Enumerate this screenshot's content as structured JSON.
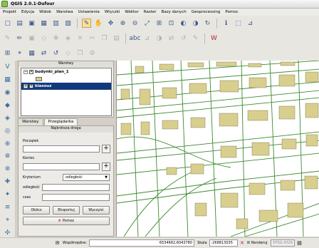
{
  "window": {
    "title": "QGIS 2.0.1-Dufour"
  },
  "menu": [
    "Projekt",
    "Edycja",
    "Widok",
    "Warstwa",
    "Ustawienia",
    "Wtyczki",
    "Wektor",
    "Raster",
    "Bazy danych",
    "Geoprocessing",
    "Pomoc"
  ],
  "toolbar_icons": {
    "row1": [
      "new-project-icon",
      "open-project-icon",
      "save-project-icon",
      "save-as-icon",
      "print-composer-icon",
      "composer-manager-icon",
      "touch-zoom-icon",
      "pan-icon",
      "pan-to-selection-icon",
      "zoom-in-icon",
      "zoom-out-icon",
      "zoom-full-icon",
      "zoom-layer-icon",
      "zoom-selection-icon",
      "zoom-last-icon",
      "zoom-next-icon",
      "refresh-icon",
      "identify-icon",
      "select-icon",
      "measure-icon"
    ],
    "row2": [
      "current-edits-icon",
      "toggle-editing-icon",
      "save-edits-icon",
      "add-feature-icon",
      "move-feature-icon",
      "node-tool-icon",
      "delete-selected-icon",
      "cut-features-icon",
      "copy-features-icon",
      "paste-features-icon",
      "label-icon",
      "pin-label-icon",
      "show-label-icon",
      "move-label-icon",
      "rotate-label-icon",
      "change-label-icon",
      "wms-icon"
    ],
    "row3": [
      "layer-label-icon",
      "pin-icon",
      "highlight-icon",
      "move-icon",
      "rotate-icon",
      "change-icon",
      "copy-icon",
      "label-settings-icon"
    ]
  },
  "vertical_toolbar": [
    "add-vector-icon",
    "add-raster-icon",
    "add-postgis-icon",
    "add-spatialite-icon",
    "add-mssql-icon",
    "add-oracle-icon",
    "add-wms-icon",
    "add-wcs-icon",
    "add-wfs-icon",
    "new-shapefile-icon",
    "new-spatialite-icon",
    "add-delimited-icon",
    "gps-icon",
    "add-geonode-icon"
  ],
  "layers_panel": {
    "header": "Warstwy",
    "layers": [
      {
        "name": "budynki_plan_1",
        "checked": "✕",
        "color": "#d8cf8f"
      },
      {
        "name": "klasouz",
        "checked": "✕",
        "color": "#4a8a2a"
      }
    ]
  },
  "tabs": [
    "Warstwy",
    "Przeglądarka"
  ],
  "path_panel": {
    "header": "Najkrótsza droga",
    "start_label": "Początek",
    "end_label": "Koniec",
    "criterion_label": "Kryterium",
    "criterion_value": "odległość",
    "distance_label": "odległość",
    "time_label": "czas",
    "start_value": "",
    "end_value": "",
    "distance_value": "",
    "time_value": "",
    "calculate_button": "Oblicz",
    "export_button": "Eksportuj",
    "clear_button": "Wyczyść",
    "help_button": "Pomoc"
  },
  "statusbar": {
    "coords_label": "Współrzędne:",
    "coords_value": "6534662,6043780",
    "scale_label": "Skala",
    "scale_value": ":268813035",
    "render_label": "Renderuj",
    "crs": "EPSG:4326"
  },
  "map_colors": {
    "road": "#3c8a2e",
    "building": "#d8cf8f",
    "building_outline": "#6b6a40",
    "background": "#ffffff"
  }
}
